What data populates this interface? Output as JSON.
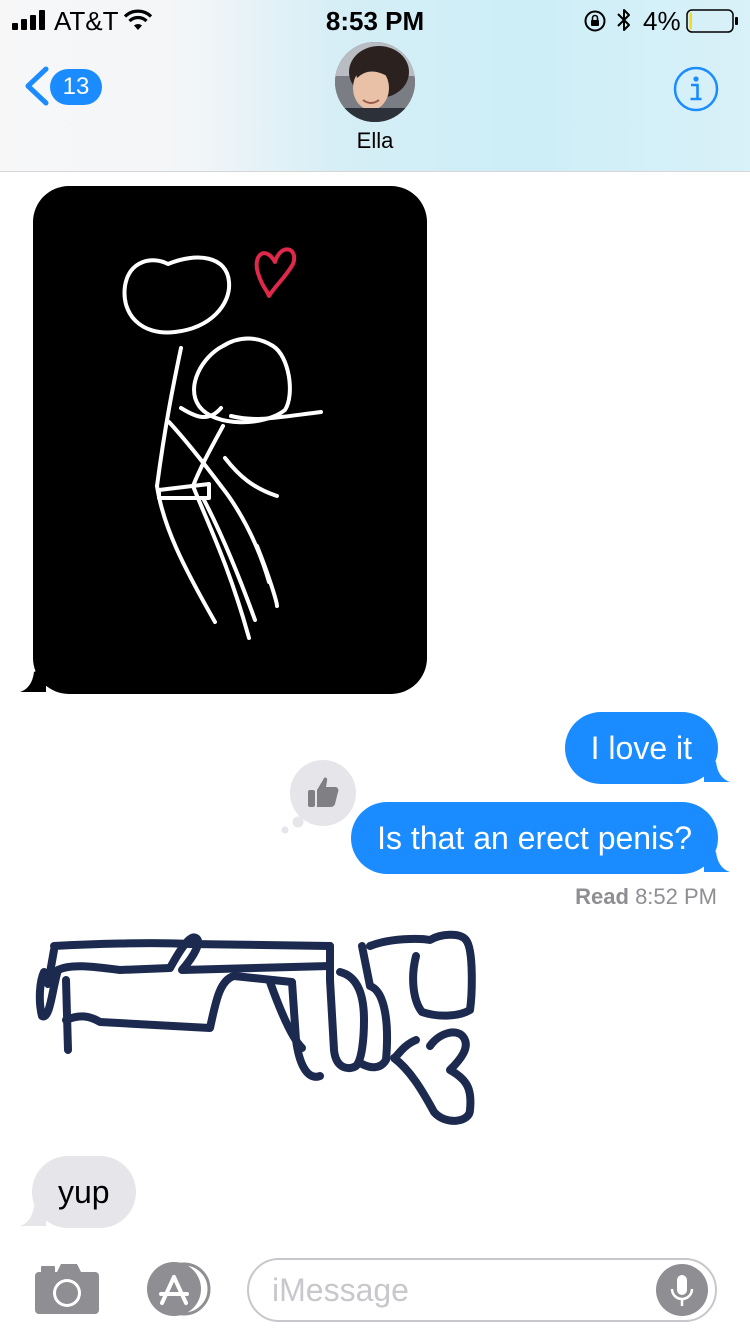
{
  "status_bar": {
    "carrier": "AT&T",
    "time": "8:53 PM",
    "battery_percent": "4%",
    "battery_level": 0.04
  },
  "nav": {
    "back_count": "13",
    "contact_name": "Ella"
  },
  "messages": [
    {
      "from": "them",
      "type": "drawing"
    },
    {
      "from": "me",
      "text": "I love it"
    },
    {
      "from": "me",
      "text": "Is that an erect penis?",
      "tapback": "thumbs-up"
    },
    {
      "from": "them",
      "type": "drawing"
    },
    {
      "from": "them",
      "text": "yup"
    }
  ],
  "read_receipt": {
    "label": "Read",
    "time": "8:52 PM"
  },
  "input": {
    "placeholder": "iMessage"
  },
  "colors": {
    "accent": "#1a8cff",
    "incoming_bubble": "#e5e5ea",
    "drawing_heart": "#e0284b",
    "drawing_ink": "#1d2a4f"
  }
}
